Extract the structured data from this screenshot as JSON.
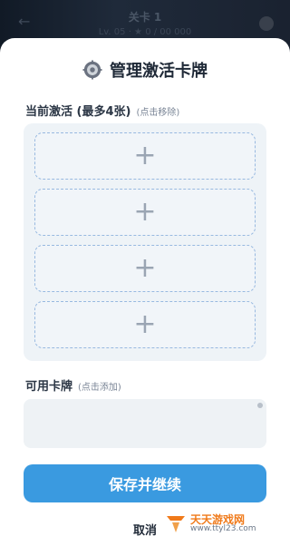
{
  "background": {
    "title": "关卡 1",
    "subtitle": "Lv. 05 · ★ 0 / 00 000",
    "icons": [
      "back-arrow-icon",
      "settings-icon"
    ]
  },
  "modal": {
    "title": "管理激活卡牌",
    "title_icon": "gear-icon",
    "active_section": {
      "label": "当前激活 (最多4张)",
      "hint": "(点击移除)",
      "slots": [
        {
          "symbol": "+"
        },
        {
          "symbol": "+"
        },
        {
          "symbol": "+"
        },
        {
          "symbol": "+"
        }
      ]
    },
    "available_section": {
      "label": "可用卡牌",
      "hint": "(点击添加)"
    },
    "save_label": "保存并继续",
    "cancel_label": "取消"
  },
  "watermark": {
    "brand": "天天游戏网",
    "url": "www.ttyl23.com"
  },
  "colors": {
    "primary_button": "#3a9ae0",
    "slot_border": "#98b9e0",
    "panel_bg": "#eef3f7",
    "watermark_orange": "#f07a1a"
  }
}
